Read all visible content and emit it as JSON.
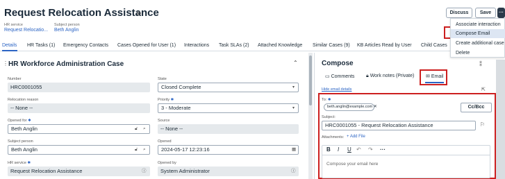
{
  "header": {
    "title": "Request Relocation Assistance",
    "tag_icon": "tag-icon",
    "meta": [
      {
        "label": "HR service",
        "value": "Request Relocatio..."
      },
      {
        "label": "Subject person",
        "value": "Beth Anglin"
      }
    ],
    "buttons": {
      "discuss": "Discuss",
      "save": "Save",
      "more": "···"
    }
  },
  "menu": {
    "items": [
      "Associate interaction",
      "Compose Email",
      "Create additional case",
      "Delete"
    ]
  },
  "tabs": [
    "Details",
    "HR Tasks (1)",
    "Emergency Contacts",
    "Cases Opened for User (1)",
    "Interactions",
    "Task SLAs (2)",
    "Attached Knowledge",
    "Similar Cases (9)",
    "KB Articles Read by User",
    "Child Cases"
  ],
  "form": {
    "title": "HR Workforce Administration Case",
    "fields": {
      "number": {
        "label": "Number",
        "value": "HRC0001055"
      },
      "state": {
        "label": "State",
        "value": "Closed Complete"
      },
      "relocation_reason": {
        "label": "Relocation reason",
        "value": "-- None --"
      },
      "priority": {
        "label": "Priority",
        "value": "3 - Moderate"
      },
      "opened_for": {
        "label": "Opened for",
        "value": "Beth Anglin"
      },
      "source": {
        "label": "Source",
        "value": "-- None --"
      },
      "subject_person": {
        "label": "Subject person",
        "value": "Beth Anglin"
      },
      "opened": {
        "label": "Opened",
        "value": "2024-05-17 12:23:16"
      },
      "hr_service": {
        "label": "HR service",
        "value": "Request Relocation Assistance"
      },
      "opened_by": {
        "label": "Opened by",
        "value": "System Administrator"
      }
    }
  },
  "compose": {
    "title": "Compose",
    "tabs": {
      "comments": "Comments",
      "work_notes": "Work notes (Private)",
      "email": "Email"
    },
    "hide_details": "Hide email details",
    "to_label": "To:",
    "to_chip": "beth.anglin@example.com",
    "cc_bcc": "Cc/Bcc",
    "subject_label": "Subject:",
    "subject_value": "HRC0001055 - Request Relocation Assistance",
    "attachments_label": "Attachments:",
    "add_file": "+ Add File",
    "toolbar": {
      "bold": "B",
      "italic": "I",
      "underline": "U",
      "undo": "↶",
      "redo": "↷",
      "more": "···"
    },
    "body_placeholder": "Compose your email here"
  },
  "colors": {
    "accent": "#2b64c4",
    "highlight": "#cc1f1f",
    "readonly_bg": "#e5e9ec"
  }
}
